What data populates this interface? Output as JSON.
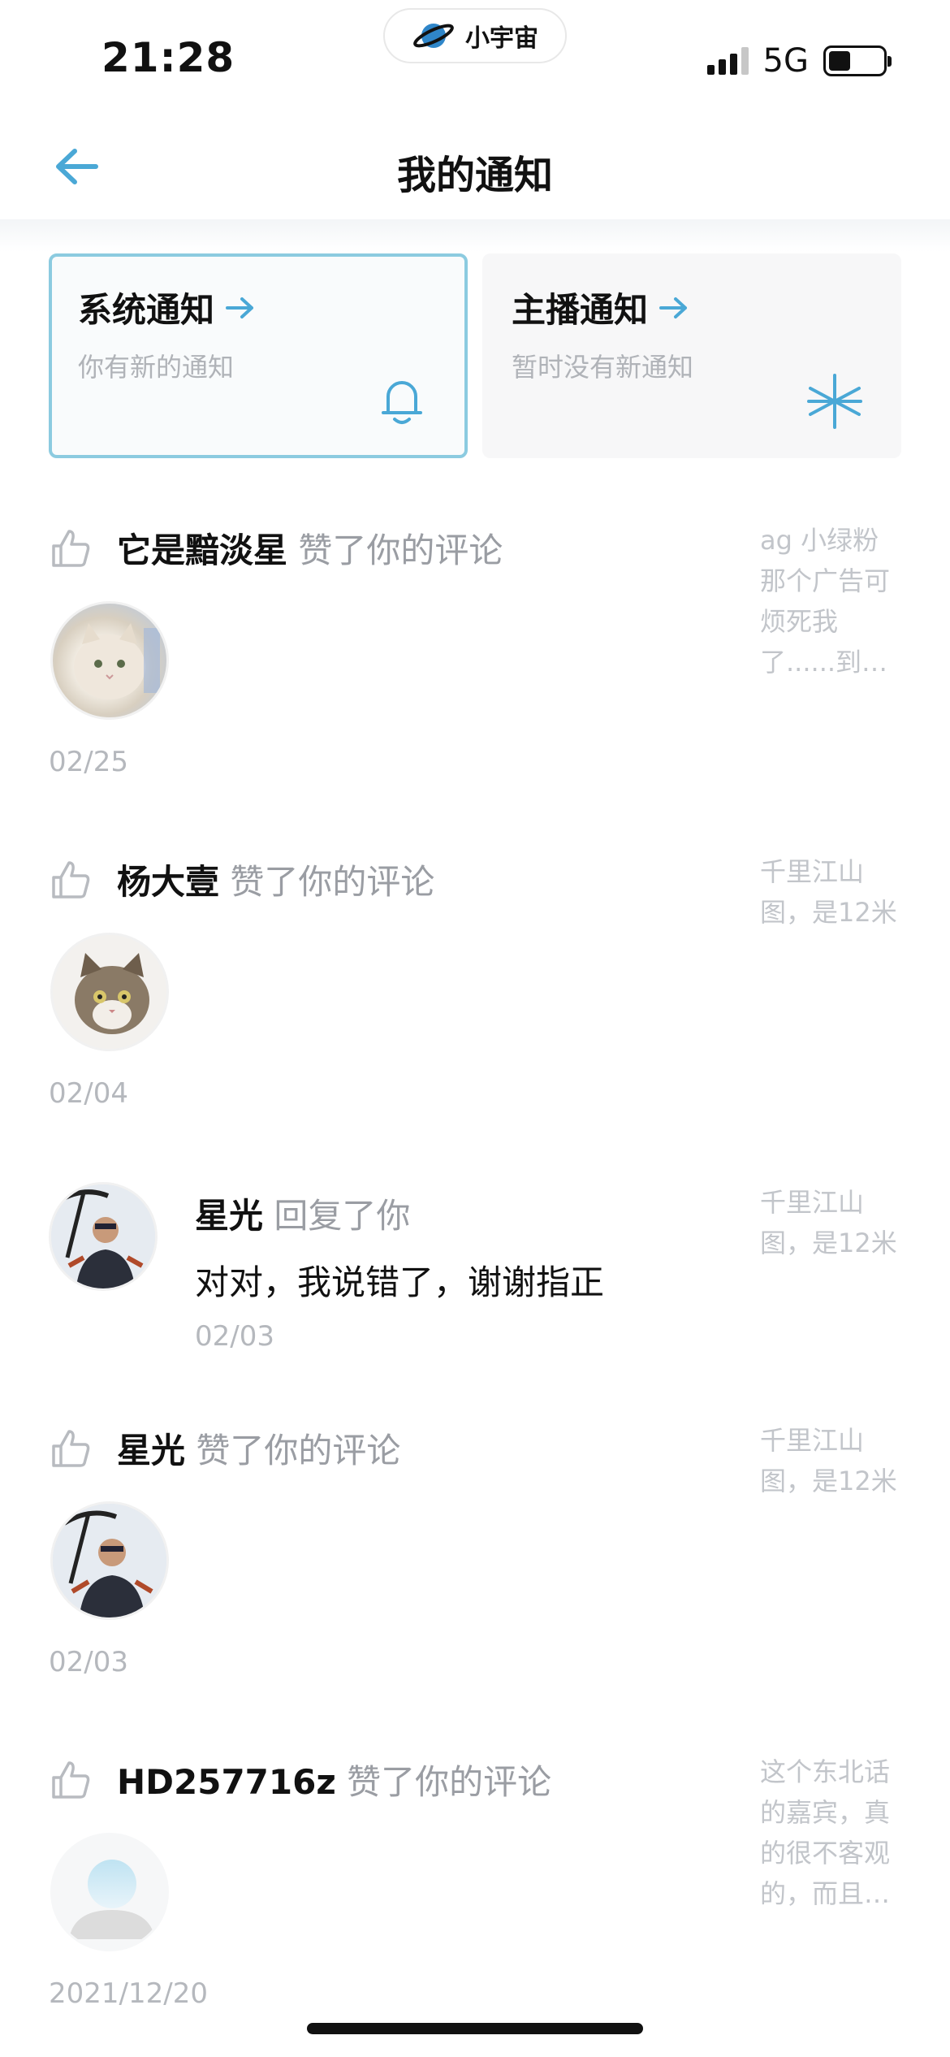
{
  "status_bar": {
    "time": "21:28",
    "network": "5G",
    "app_pill": "小宇宙"
  },
  "header": {
    "title": "我的通知"
  },
  "cards": [
    {
      "title": "系统通知",
      "subtitle": "你有新的通知",
      "icon": "bell-icon"
    },
    {
      "title": "主播通知",
      "subtitle": "暂时没有新通知",
      "icon": "asterisk-icon"
    }
  ],
  "notifications": [
    {
      "name": "它是黯淡星",
      "action": "赞了你的评论",
      "date": "02/25",
      "preview": "ag 小绿粉那个广告可烦死我了......到…"
    },
    {
      "name": "杨大壹",
      "action": "赞了你的评论",
      "date": "02/04",
      "preview": "千里江山图，是12米"
    },
    {
      "name": "星光",
      "action": "回复了你",
      "reply": "对对，我说错了，谢谢指正",
      "date": "02/03",
      "preview": "千里江山图，是12米"
    },
    {
      "name": "星光",
      "action": "赞了你的评论",
      "date": "02/03",
      "preview": "千里江山图，是12米"
    },
    {
      "name": "HD257716z",
      "action": "赞了你的评论",
      "date": "2021/12/20",
      "preview": "这个东北话的嘉宾，真的很不客观的，而且…"
    }
  ],
  "colors": {
    "accent": "#4aa8d6",
    "card_border": "#8ccbe0",
    "muted": "#9a9da3"
  }
}
